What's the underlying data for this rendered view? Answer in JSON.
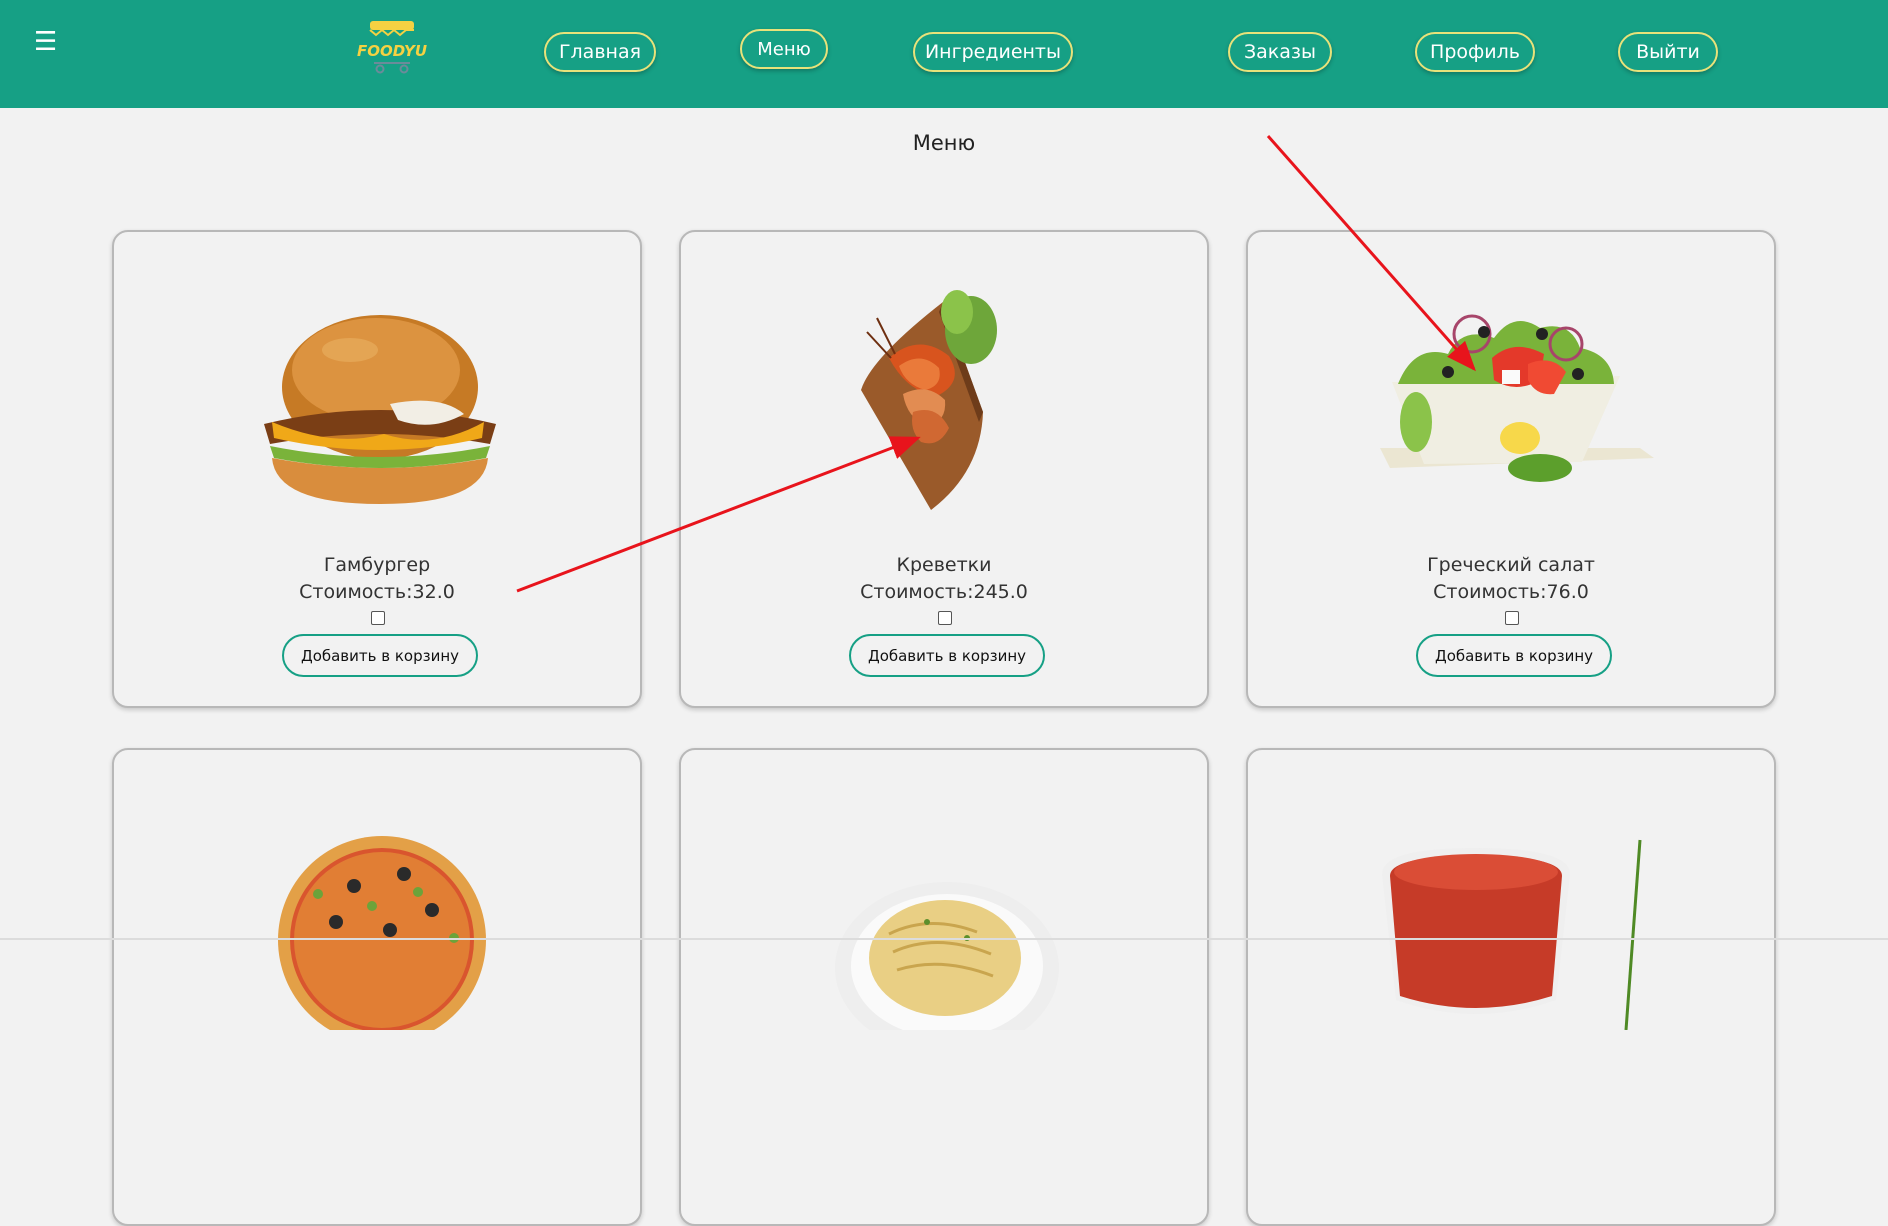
{
  "header": {
    "menu_icon": "☰",
    "logo_text": "FOODYU",
    "nav": [
      {
        "label": "Главная"
      },
      {
        "label": "Меню"
      },
      {
        "label": "Ингредиенты"
      },
      {
        "label": "Заказы"
      },
      {
        "label": "Профиль"
      },
      {
        "label": "Выйти"
      }
    ],
    "active_nav": "Меню"
  },
  "main": {
    "title": "Меню",
    "price_prefix": "Стоимость:",
    "add_to_cart_label": "Добавить в корзину",
    "items": [
      {
        "name": "Гамбургер",
        "price_text": "Стоимость:32.0",
        "price": 32.0,
        "image": "hamburger-image",
        "checked": false
      },
      {
        "name": "Креветки",
        "price_text": "Стоимость:245.0",
        "price": 245.0,
        "image": "shrimp-image",
        "checked": false
      },
      {
        "name": "Греческий салат",
        "price_text": "Стоимость:76.0",
        "price": 76.0,
        "image": "greek-salad-image",
        "checked": false
      },
      {
        "name": "",
        "price_text": "",
        "image": "pizza-image"
      },
      {
        "name": "",
        "price_text": "",
        "image": "pasta-image"
      },
      {
        "name": "",
        "price_text": "",
        "image": "tomato-soup-image"
      }
    ]
  },
  "colors": {
    "header_bg": "#16a085",
    "nav_border": "#e8e27a",
    "button_border": "#16a085",
    "page_bg": "#f2f2f2",
    "annotation_arrow": "#e8141c"
  },
  "annotations": [
    {
      "name": "red-arrow-to-shrimp"
    },
    {
      "name": "red-arrow-to-salad"
    }
  ]
}
